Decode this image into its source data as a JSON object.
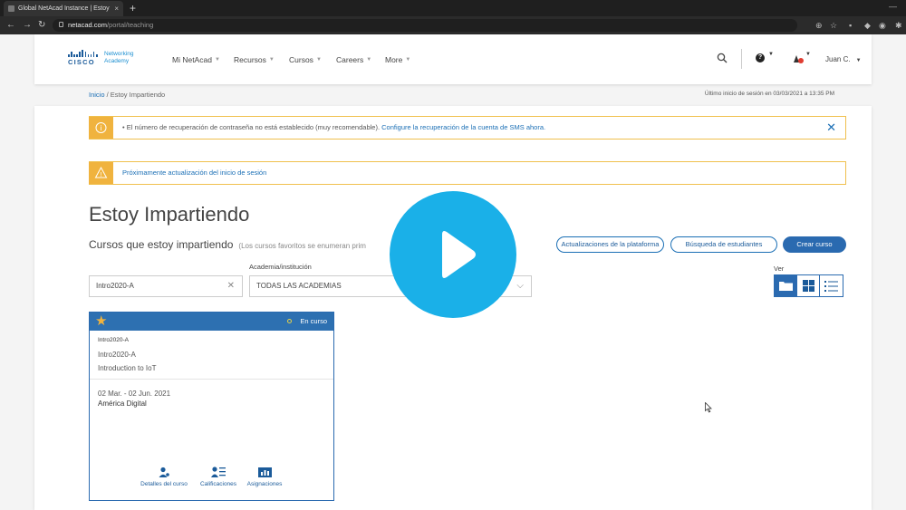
{
  "browser": {
    "tab_title": "Global NetAcad Instance | Estoy",
    "tab_close": "×",
    "new_tab": "+",
    "window_min": "—",
    "url_host": "netacad.com",
    "url_path": "/portal/teaching"
  },
  "header": {
    "logo_line1": "Networking",
    "logo_line2": "Academy",
    "logo_cisco": "CISCO",
    "menu": [
      "Mi NetAcad",
      "Recursos",
      "Cursos",
      "Careers",
      "More"
    ],
    "user": "Juan C."
  },
  "breadcrumb": {
    "home": "Inicio",
    "separator": " / ",
    "current": "Estoy Impartiendo"
  },
  "last_login": "Último inicio de sesión en 03/03/2021 a 13:35 PM",
  "alerts": {
    "recovery_text": "•  El número de recuperación de contraseña no está establecido (muy recomendable).",
    "recovery_link": "Configure la recuperación de la cuenta de SMS ahora.",
    "login_update": "Próximamente actualización del inicio de sesión"
  },
  "page": {
    "title": "Estoy Impartiendo",
    "subtitle": "Cursos que estoy impartiendo",
    "subtitle_note": "(Los cursos favoritos se enumeran prim"
  },
  "buttons": {
    "platform_updates": "Actualizaciones de la plataforma",
    "student_search": "Búsqueda de estudiantes",
    "create_course": "Crear curso"
  },
  "filters": {
    "search_value": "Intro2020-A",
    "academy_label": "Academia/institución",
    "academy_value": "TODAS LAS ACADEMIAS",
    "view_label": "Ver"
  },
  "course": {
    "status": "En curso",
    "code": "Intro2020-A",
    "name": "Intro2020-A",
    "title": "Introduction to IoT",
    "dates": "02 Mar. - 02 Jun. 2021",
    "institution": "América Digital",
    "actions": [
      "Detalles del curso",
      "Calificaciones",
      "Asignaciones"
    ]
  },
  "colors": {
    "brand_blue": "#2a6ab0",
    "alert_yellow": "#f0b33e",
    "play_button": "#1ab0e8"
  }
}
